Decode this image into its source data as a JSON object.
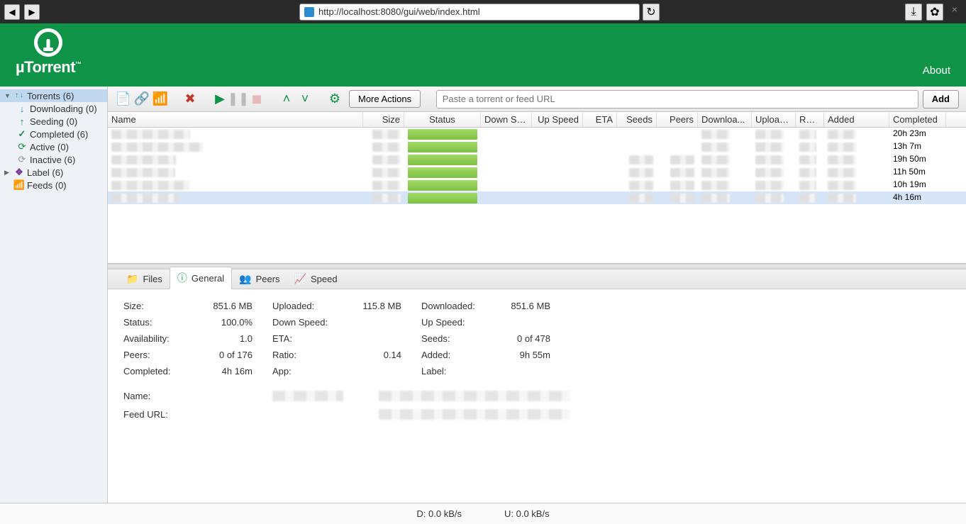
{
  "browser": {
    "url": "http://localhost:8080/gui/web/index.html"
  },
  "header": {
    "logo_text": "µTorrent",
    "about": "About"
  },
  "sidebar": {
    "torrents": "Torrents (6)",
    "downloading": "Downloading (0)",
    "seeding": "Seeding (0)",
    "completed": "Completed (6)",
    "active": "Active (0)",
    "inactive": "Inactive (6)",
    "label": "Label (6)",
    "feeds": "Feeds (0)"
  },
  "toolbar": {
    "more_actions": "More Actions",
    "paste_placeholder": "Paste a torrent or feed URL",
    "add": "Add"
  },
  "columns": {
    "name": "Name",
    "size": "Size",
    "status": "Status",
    "down_speed": "Down Sp...",
    "up_speed": "Up Speed",
    "eta": "ETA",
    "seeds": "Seeds",
    "peers": "Peers",
    "downloaded": "Downloa...",
    "uploaded": "Uploaded",
    "ratio": "Ratio",
    "added": "Added",
    "completed": "Completed"
  },
  "rows": [
    {
      "completed": "20h 23m"
    },
    {
      "completed": "13h 7m"
    },
    {
      "completed": "19h 50m"
    },
    {
      "completed": "11h 50m"
    },
    {
      "completed": "10h 19m"
    },
    {
      "completed": "4h 16m"
    }
  ],
  "tabs": {
    "files": "Files",
    "general": "General",
    "peers": "Peers",
    "speed": "Speed"
  },
  "general": {
    "size_l": "Size:",
    "size_v": "851.6 MB",
    "uploaded_l": "Uploaded:",
    "uploaded_v": "115.8 MB",
    "downloaded_l": "Downloaded:",
    "downloaded_v": "851.6 MB",
    "status_l": "Status:",
    "status_v": "100.0%",
    "dsp_l": "Down Speed:",
    "dsp_v": "",
    "usp_l": "Up Speed:",
    "usp_v": "",
    "avail_l": "Availability:",
    "avail_v": "1.0",
    "eta_l": "ETA:",
    "eta_v": "",
    "seeds_l": "Seeds:",
    "seeds_v": "0 of 478",
    "peers_l": "Peers:",
    "peers_v": "0 of 176",
    "ratio_l": "Ratio:",
    "ratio_v": "0.14",
    "added_l": "Added:",
    "added_v": "9h 55m",
    "comp_l": "Completed:",
    "comp_v": "4h 16m",
    "app_l": "App:",
    "app_v": "",
    "label_l": "Label:",
    "label_v": "",
    "name_l": "Name:",
    "feed_l": "Feed URL:"
  },
  "status": {
    "down": "D: 0.0 kB/s",
    "up": "U: 0.0 kB/s"
  }
}
